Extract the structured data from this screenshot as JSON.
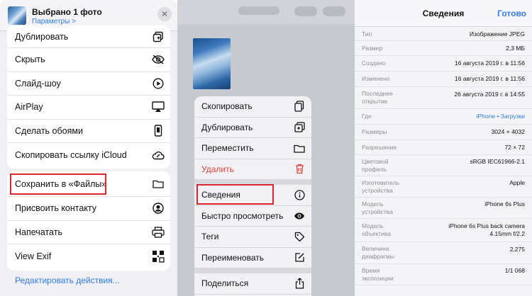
{
  "share_sheet": {
    "title": "Выбрано 1 фото",
    "params_link": "Параметры >",
    "close": "✕",
    "group1": [
      "Дублировать",
      "Скрыть",
      "Слайд-шоу",
      "AirPlay",
      "Сделать обоями",
      "Скопировать ссылку iCloud"
    ],
    "group2": [
      "Сохранить в «Файлы»",
      "Присвоить контакту",
      "Напечатать",
      "View Exif"
    ],
    "edit_actions": "Редактировать действия...",
    "icons": {
      "group1": [
        "duplicate-icon",
        "hide-eye-icon",
        "play-icon",
        "airplay-icon",
        "phone-icon",
        "link-cloud-icon"
      ],
      "group2": [
        "folder-icon",
        "contact-icon",
        "printer-icon",
        "exif-icon"
      ]
    },
    "highlighted_item": "Сохранить в «Файлы»"
  },
  "context_menu": {
    "items_top": [
      "Скопировать",
      "Дублировать",
      "Переместить",
      "Удалить"
    ],
    "items_bottom": [
      "Сведения",
      "Быстро просмотреть",
      "Теги",
      "Переименовать"
    ],
    "items_share": [
      "Поделиться"
    ],
    "highlighted_item": "Сведения",
    "danger_color": "#e5403a"
  },
  "info": {
    "title": "Сведения",
    "done": "Готово",
    "rows": [
      {
        "k": "Тип",
        "v": "Изображение JPEG"
      },
      {
        "k": "Размер",
        "v": "2,3 МБ"
      },
      {
        "k": "Создано",
        "v": "16 августа 2019 г. в 11:56"
      },
      {
        "k": "Изменено",
        "v": "16 августа 2019 г. в 11:56"
      },
      {
        "k": "Последнее\nоткрытие",
        "v": "26 августа 2019 г. в 14:55"
      },
      {
        "k": "Где",
        "v": "iPhone • Загрузки",
        "link": true
      },
      {
        "k": "Размеры",
        "v": "3024 × 4032"
      },
      {
        "k": "Разрешение",
        "v": "72 × 72"
      },
      {
        "k": "Цветовой\nпрофиль",
        "v": "sRGB IEC61966-2.1"
      },
      {
        "k": "Изготовитель\nустройства",
        "v": "Apple"
      },
      {
        "k": "Модель\nустройства",
        "v": "iPhone 6s Plus"
      },
      {
        "k": "Модель\nобъектива",
        "v": "iPhone 6s Plus back camera\n4.15mm f/2.2"
      },
      {
        "k": "Величина\nдиафрагмы",
        "v": "2,275"
      },
      {
        "k": "Время\nэкспозиции",
        "v": "1/1 068"
      }
    ]
  },
  "colors": {
    "accent": "#2f7cf6",
    "highlight_box": "#e0242f"
  }
}
